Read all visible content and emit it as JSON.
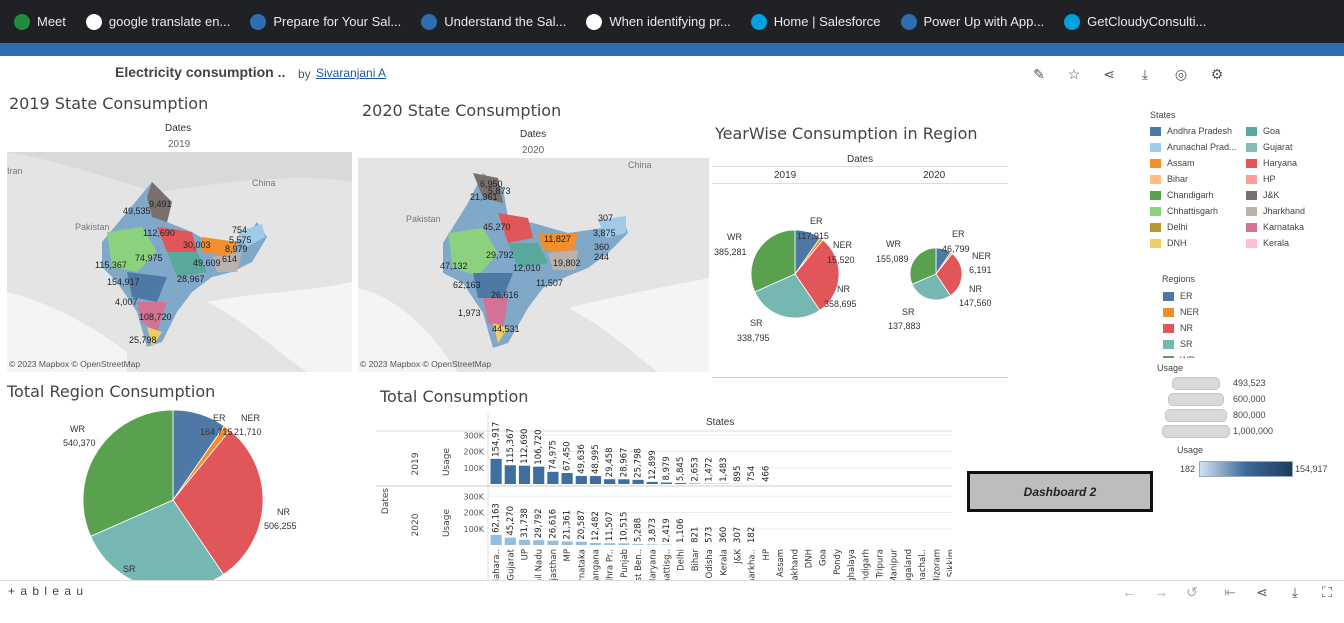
{
  "bookmarks": [
    {
      "label": "Meet",
      "color": "#1e8e3e",
      "icon": "meet-icon"
    },
    {
      "label": "google translate en...",
      "color": "#ffffff",
      "icon": "google-icon"
    },
    {
      "label": "Prepare for Your Sal...",
      "color": "#2d6fb2",
      "icon": "trailhead-icon"
    },
    {
      "label": "Understand the Sal...",
      "color": "#2d6fb2",
      "icon": "trailhead-icon"
    },
    {
      "label": "When identifying pr...",
      "color": "#ffffff",
      "icon": "google-icon"
    },
    {
      "label": "Home | Salesforce",
      "color": "#00a1e0",
      "icon": "salesforce-cloud-icon"
    },
    {
      "label": "Power Up with App...",
      "color": "#2d6fb2",
      "icon": "trailhead-icon"
    },
    {
      "label": "GetCloudyConsulti...",
      "color": "#00a1e0",
      "icon": "salesforce-cloud-icon"
    }
  ],
  "header": {
    "title": "Electricity consumption ..",
    "by": "by",
    "author": "Sivaranjani A"
  },
  "map2019": {
    "title": "2019 State Consumption",
    "dates_label": "Dates",
    "year": "2019",
    "attribution": "© 2023 Mapbox © OpenStreetMap",
    "places": {
      "iran": "Iran",
      "pakistan": "Pakistan",
      "china": "China"
    },
    "labels": [
      "9,491",
      "49,535",
      "112,690",
      "74,975",
      "115,367",
      "154,917",
      "4,007",
      "108,720",
      "25,798",
      "30,003",
      "5,575",
      "754",
      "8,979",
      "614",
      "49,609",
      "28,967"
    ]
  },
  "map2020": {
    "title": "2020 State Consumption",
    "dates_label": "Dates",
    "year": "2020",
    "attribution": "© 2023 Mapbox © OpenStreetMap",
    "places": {
      "pakistan": "Pakistan",
      "china": "China"
    },
    "labels": [
      "6,950",
      "5,873",
      "21,361",
      "45,270",
      "29,792",
      "47,132",
      "62,163",
      "12,010",
      "19,802",
      "11,507",
      "26,616",
      "1,973",
      "44,531",
      "11,827",
      "307",
      "3,875",
      "360",
      "244"
    ]
  },
  "yearwise": {
    "title": "YearWise Consumption in Region",
    "dates_label": "Dates",
    "y2019": {
      "year": "2019",
      "labels": {
        "wr": "WR",
        "wr_v": "385,281",
        "er": "ER",
        "er_v": "117,915",
        "ner": "NER",
        "ner_v": "15,520",
        "nr": "NR",
        "nr_v": "358,695",
        "sr": "SR",
        "sr_v": "338,795"
      }
    },
    "y2020": {
      "year": "2020",
      "labels": {
        "wr": "WR",
        "wr_v": "155,089",
        "er": "ER",
        "er_v": "46,799",
        "ner": "NER",
        "ner_v": "6,191",
        "nr": "NR",
        "nr_v": "147,560",
        "sr": "SR",
        "sr_v": "137,883"
      }
    }
  },
  "total_region": {
    "title": "Total Region Consumption",
    "labels": {
      "wr": "WR",
      "wr_v": "540,370",
      "er": "ER",
      "er_v": "164,715",
      "ner": "NER",
      "ner_v": "21,710",
      "nr": "NR",
      "nr_v": "506,255",
      "sr": "SR"
    }
  },
  "total": {
    "title": "Total Consumption",
    "states_label": "States",
    "dates_label": "Dates",
    "usage_label": "Usage",
    "ticks": [
      "300K",
      "200K",
      "100K"
    ],
    "years": [
      "2019",
      "2020"
    ]
  },
  "legend_states": {
    "title": "States",
    "items": [
      {
        "label": "Andhra Pradesh",
        "color": "#4e79a7"
      },
      {
        "label": "Goa",
        "color": "#59a89c"
      },
      {
        "label": "Arunachal Prad...",
        "color": "#a0cbe8"
      },
      {
        "label": "Gujarat",
        "color": "#86bcb6"
      },
      {
        "label": "Assam",
        "color": "#f28e2b"
      },
      {
        "label": "Haryana",
        "color": "#e15759"
      },
      {
        "label": "Bihar",
        "color": "#ffbe7d"
      },
      {
        "label": "HP",
        "color": "#ff9d9a"
      },
      {
        "label": "Chandigarh",
        "color": "#59a14f"
      },
      {
        "label": "J&K",
        "color": "#79706e"
      },
      {
        "label": "Chhattisgarh",
        "color": "#8cd17d"
      },
      {
        "label": "Jharkhand",
        "color": "#bab0ac"
      },
      {
        "label": "Delhi",
        "color": "#b6992d"
      },
      {
        "label": "Karnataka",
        "color": "#d37295"
      },
      {
        "label": "DNH",
        "color": "#f1ce63"
      },
      {
        "label": "Kerala",
        "color": "#fabfd2"
      }
    ]
  },
  "legend_regions": {
    "title": "Regions",
    "items": [
      {
        "label": "ER",
        "color": "#4e79a7"
      },
      {
        "label": "NER",
        "color": "#f28e2b"
      },
      {
        "label": "NR",
        "color": "#e15759"
      },
      {
        "label": "SR",
        "color": "#76b7b2"
      },
      {
        "label": "WR",
        "color": "#59a14f"
      }
    ]
  },
  "legend_usage": {
    "title": "Usage",
    "items": [
      "493,523",
      "600,000",
      "800,000",
      "1,000,000"
    ]
  },
  "legend_usage2": {
    "title": "Usage",
    "min": "182",
    "max": "154,917"
  },
  "dashboard2_label": "Dashboard 2",
  "footer": {
    "brand": "+ a b l e a u"
  },
  "chart_data": [
    {
      "type": "pie",
      "title": "YearWise Consumption in Region - 2019",
      "categories": [
        "ER",
        "NER",
        "NR",
        "SR",
        "WR"
      ],
      "values": [
        117915,
        15520,
        358695,
        338795,
        385281
      ]
    },
    {
      "type": "pie",
      "title": "YearWise Consumption in Region - 2020",
      "categories": [
        "ER",
        "NER",
        "NR",
        "SR",
        "WR"
      ],
      "values": [
        46799,
        6191,
        147560,
        137883,
        155089
      ]
    },
    {
      "type": "pie",
      "title": "Total Region Consumption",
      "categories": [
        "ER",
        "NER",
        "NR",
        "SR",
        "WR"
      ],
      "values": [
        164715,
        21710,
        506255,
        476678,
        540370
      ]
    },
    {
      "type": "bar",
      "title": "Total Consumption",
      "categories": [
        "Maharashtra",
        "Gujarat",
        "UP",
        "Tamil Nadu",
        "Rajasthan",
        "MP",
        "Karnataka",
        "Telangana",
        "Andhra Pradesh",
        "Punjab",
        "West Bengal",
        "Haryana",
        "Chhattisgarh",
        "Delhi",
        "Bihar",
        "Odisha",
        "Kerala",
        "J&K",
        "Jharkhand",
        "HP",
        "Assam",
        "Uttarakhand",
        "DNH",
        "Goa",
        "Pondy",
        "Meghalaya",
        "Chandigarh",
        "Tripura",
        "Manipur",
        "Nagaland",
        "Arunachal Pradesh",
        "Mizoram",
        "Sikkim"
      ],
      "series": [
        {
          "name": "2019",
          "values": [
            154917,
            115367,
            112690,
            106720,
            74975,
            67450,
            49636,
            48995,
            29458,
            28967,
            25798,
            12899,
            8979,
            5845,
            2653,
            1472,
            1483,
            895,
            754,
            466,
            0,
            0,
            0,
            0,
            0,
            0,
            0,
            0,
            0,
            0,
            0,
            0,
            0
          ]
        },
        {
          "name": "2020",
          "values": [
            62163,
            45270,
            31738,
            29792,
            26616,
            21361,
            20587,
            12482,
            11507,
            10515,
            5288,
            3873,
            2419,
            1106,
            821,
            573,
            360,
            307,
            182,
            0,
            0,
            0,
            0,
            0,
            0,
            0,
            0,
            0,
            0,
            0,
            0,
            0,
            0
          ]
        }
      ],
      "value_labels_2019": [
        "154,917",
        "115,367",
        "112,690",
        "106,720",
        "74,975",
        "67,450",
        "49,636",
        "48,995",
        "29,458",
        "28,967",
        "25,798",
        "12,899",
        "8,979",
        "5,845",
        "2,653",
        "1,472",
        "1,483",
        "895",
        "754",
        "466"
      ],
      "value_labels_2020": [
        "62,163",
        "45,270",
        "31,738",
        "29,792",
        "26,616",
        "21,361",
        "20,587",
        "12,482",
        "11,507",
        "10,515",
        "5,288",
        "3,873",
        "2,419",
        "1,106",
        "821",
        "573",
        "360",
        "307",
        "182"
      ],
      "category_labels": [
        "Mahara..",
        "Gujarat",
        "UP",
        "Tamil Nadu",
        "Rajasthan",
        "MP",
        "Karnataka",
        "Telangana",
        "Andhra Pr..",
        "Punjab",
        "West Ben..",
        "Haryana",
        "Chhattisg..",
        "Delhi",
        "Bihar",
        "Odisha",
        "Kerala",
        "J&K",
        "Jharkha..",
        "HP",
        "Assam",
        "Uttarakhand",
        "DNH",
        "Goa",
        "Pondy",
        "Meghalaya",
        "Chandigarh",
        "Tripura",
        "Manipur",
        "Nagaland",
        "Arunachal..",
        "Mizoram",
        "Sikkim"
      ],
      "ylabel": "Usage",
      "ylim": [
        0,
        320000
      ]
    }
  ]
}
